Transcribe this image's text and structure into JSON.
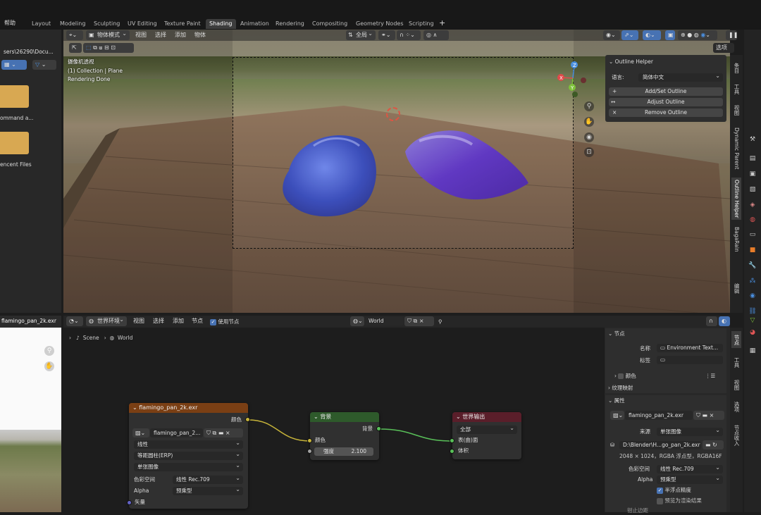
{
  "top": {
    "help": "帮助",
    "tabs": [
      "Layout",
      "Modeling",
      "Sculpting",
      "UV Editing",
      "Texture Paint",
      "Shading",
      "Animation",
      "Rendering",
      "Compositing",
      "Geometry Nodes",
      "Scripting"
    ],
    "active_tab": "Shading",
    "add_tab": "+"
  },
  "filebrowser": {
    "path": "sers\\26290\\Docu...",
    "items": [
      "ommand a...",
      "encent Files"
    ]
  },
  "viewport": {
    "mode": "物体模式",
    "menus": [
      "视图",
      "选择",
      "添加",
      "物体"
    ],
    "transform": "全局",
    "options": "选项",
    "overlay_lines": [
      "摄像机透视",
      "(1) Collection | Plane",
      "Rendering Done"
    ]
  },
  "outline_helper": {
    "title": "Outline Helper",
    "lang_label": "语言:",
    "lang_value": "简体中文",
    "buttons": [
      "Add/Set Outline",
      "Adjust Outline",
      "Remove Outline"
    ]
  },
  "right_vtabs": [
    "条目",
    "工具",
    "视图",
    "Dynamic Parent",
    "Outline Helper",
    "BagaRain",
    "编辑"
  ],
  "image_editor": {
    "file": "flamingo_pan_2k.exr"
  },
  "node_editor": {
    "world_env": "世界环境",
    "menus": [
      "视图",
      "选择",
      "添加",
      "节点"
    ],
    "use_nodes": "使用节点",
    "world_name": "World",
    "breadcrumb": [
      "Scene",
      "World"
    ]
  },
  "nodes": {
    "env": {
      "title": "flamingo_pan_2k.exr",
      "out_color": "颜色",
      "image": "flamingo_pan_2...",
      "interp": "线性",
      "proj": "等距圆柱(ERP)",
      "single": "单张图像",
      "cs_label": "色彩空间",
      "cs_value": "线性 Rec.709",
      "alpha_label": "Alpha",
      "alpha_value": "预乘型",
      "vector": "矢量"
    },
    "bg": {
      "title": "背景",
      "out": "背景",
      "color": "颜色",
      "strength_label": "强度",
      "strength_value": "2.100"
    },
    "out": {
      "title": "世界输出",
      "target": "全部",
      "surface": "表(曲)面",
      "volume": "体积"
    }
  },
  "nprops": {
    "node_section": "节点",
    "name_label": "名称",
    "name_value": "Environment Text...",
    "label_label": "标签",
    "color_label": "颜色",
    "texmap": "纹理映射",
    "props": "属性",
    "image_name": "flamingo_pan_2k.exr",
    "source_label": "来源",
    "source_value": "单张图像",
    "path": "D:\\Blender\\H...go_pan_2k.exr",
    "info": "2048 × 1024，RGBA 浮点型，RGBA16F",
    "cs_label": "色彩空间",
    "cs_value": "线性 Rec.709",
    "alpha_label": "Alpha",
    "alpha_value": "预乘型",
    "half_float": "半浮点精度",
    "premul": "预览为渲染结果",
    "last": "钳止边距"
  },
  "nprop_vtabs": [
    "节点",
    "工具",
    "视图",
    "选项",
    "节点收入"
  ],
  "colors": {
    "accent": "#4772b3",
    "env_header": "#7a3f14",
    "bg_header": "#2e5a2b",
    "out_header": "#5a1e2a"
  }
}
